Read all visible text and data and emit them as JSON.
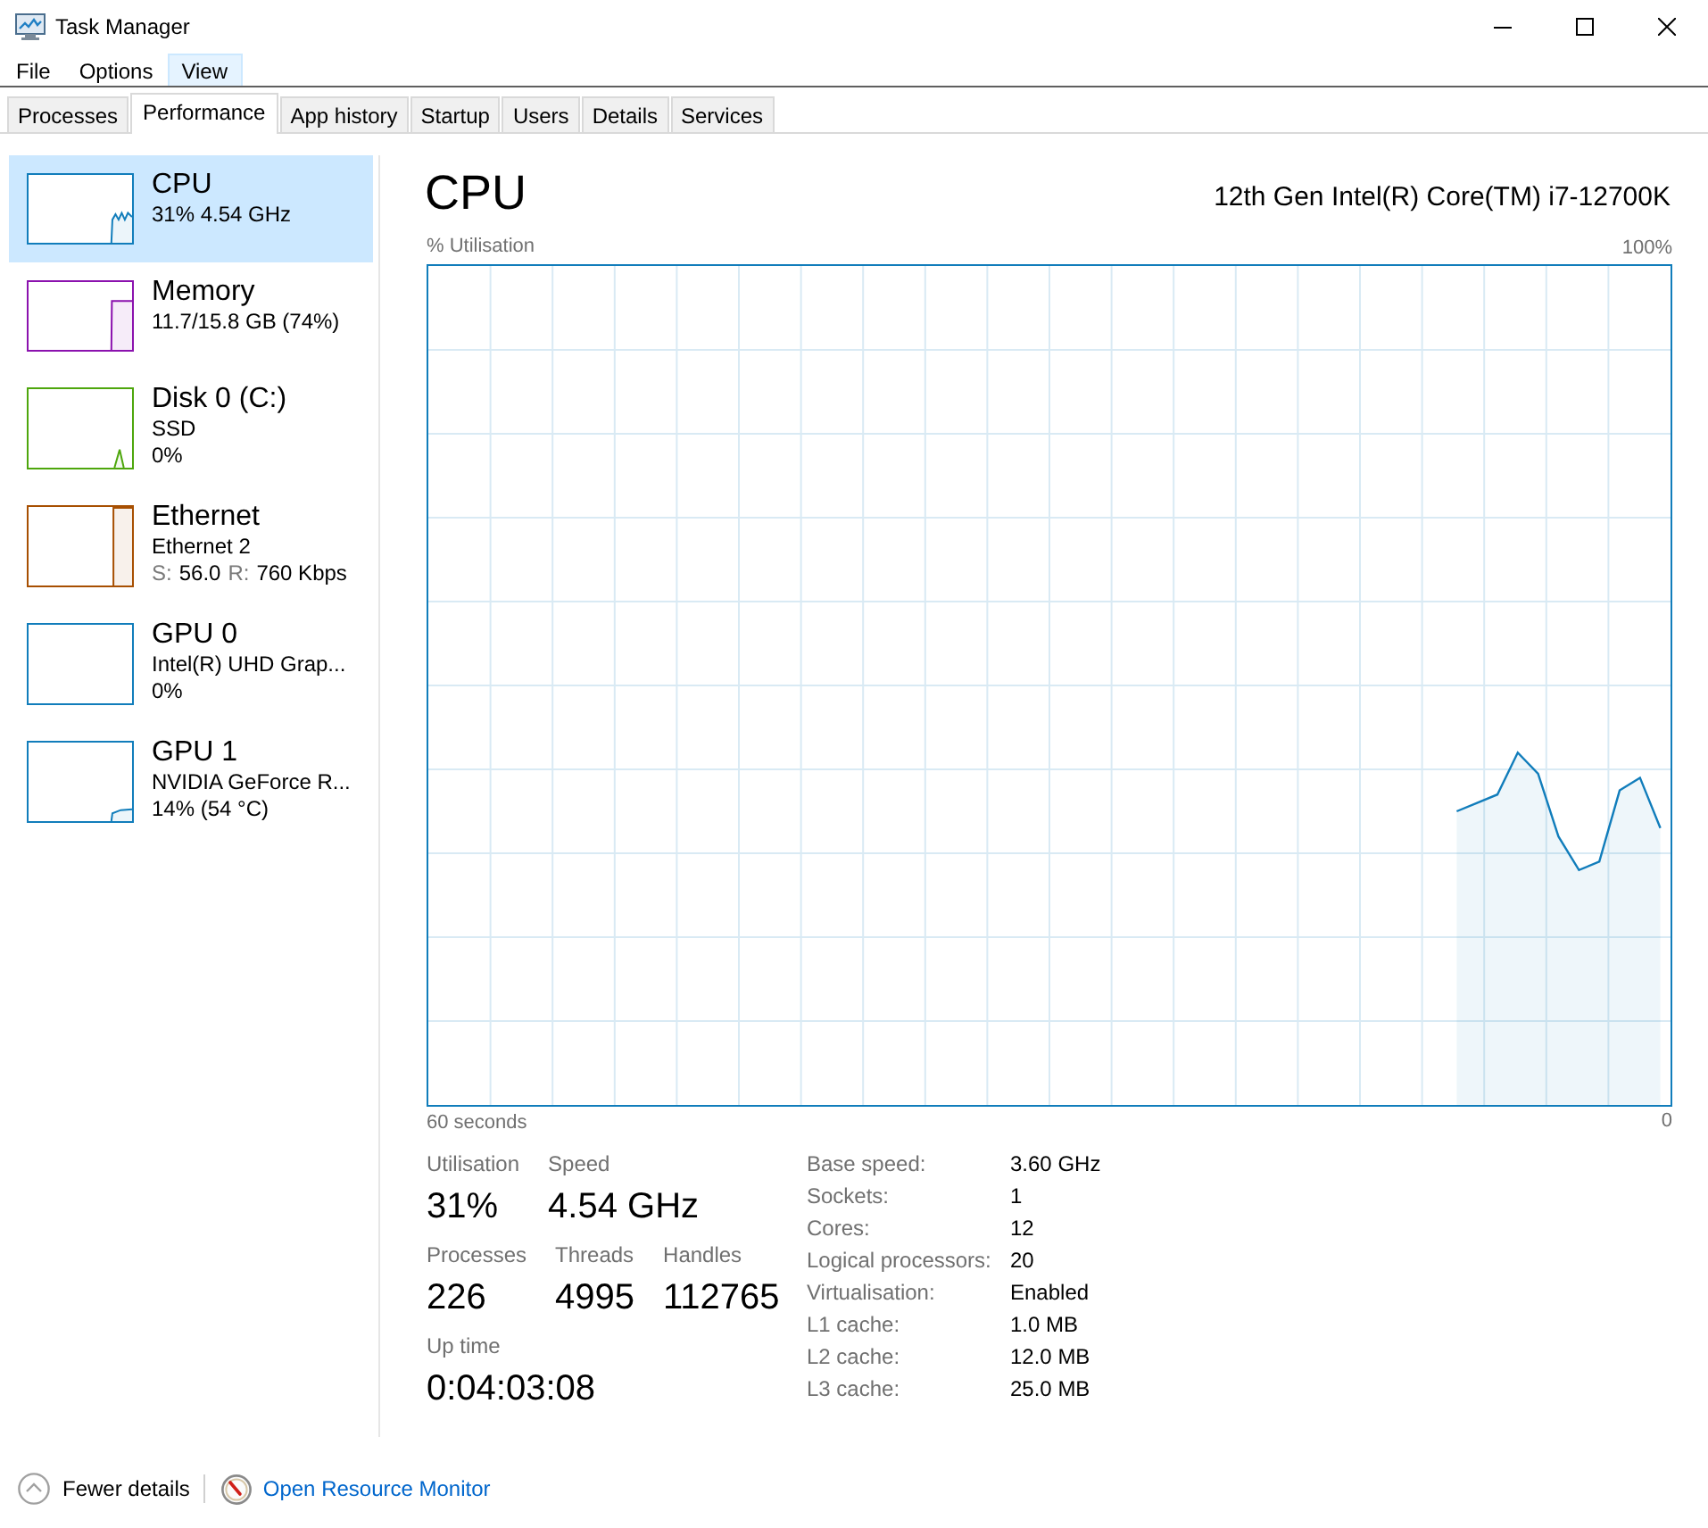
{
  "window": {
    "title": "Task Manager"
  },
  "menu": [
    {
      "label": "File",
      "selected": false
    },
    {
      "label": "Options",
      "selected": false
    },
    {
      "label": "View",
      "selected": true
    }
  ],
  "tabs": [
    {
      "label": "Processes",
      "selected": false
    },
    {
      "label": "Performance",
      "selected": true
    },
    {
      "label": "App history",
      "selected": false
    },
    {
      "label": "Startup",
      "selected": false
    },
    {
      "label": "Users",
      "selected": false
    },
    {
      "label": "Details",
      "selected": false
    },
    {
      "label": "Services",
      "selected": false
    }
  ],
  "sidebar": {
    "items": [
      {
        "name": "CPU",
        "lines": [
          "31% 4.54 GHz"
        ],
        "color": "#117dbb",
        "selected": true
      },
      {
        "name": "Memory",
        "lines": [
          "11.7/15.8 GB (74%)"
        ],
        "color": "#8b12ae",
        "selected": false
      },
      {
        "name": "Disk 0 (C:)",
        "lines": [
          "SSD",
          "0%"
        ],
        "color": "#4da60c",
        "selected": false
      },
      {
        "name": "Ethernet",
        "lines": [
          "Ethernet 2"
        ],
        "throughput": {
          "send_label": "S:",
          "send": "56.0",
          "receive_label": "R:",
          "receive": "760 Kbps"
        },
        "color": "#a74f01",
        "selected": false
      },
      {
        "name": "GPU 0",
        "lines": [
          "Intel(R) UHD Grap...",
          "0%"
        ],
        "color": "#117dbb",
        "selected": false
      },
      {
        "name": "GPU 1",
        "lines": [
          "NVIDIA GeForce R...",
          "14% (54 °C)"
        ],
        "color": "#117dbb",
        "selected": false
      }
    ]
  },
  "performance": {
    "title": "CPU",
    "model": "12th Gen Intel(R) Core(TM) i7-12700K",
    "chart_data": {
      "type": "area",
      "ylabel": "% Utilisation",
      "xlabel": "60 seconds",
      "grid": true,
      "categories": [
        null,
        null,
        null,
        null,
        null,
        null,
        null,
        null,
        null,
        null,
        null,
        null,
        null,
        null,
        null,
        null,
        null,
        null,
        null,
        null,
        null,
        null,
        null,
        null,
        null,
        null,
        null,
        null,
        null,
        null,
        null,
        null,
        null,
        null,
        null,
        null,
        null,
        null,
        null,
        null,
        null,
        null,
        null,
        null,
        null,
        null,
        null,
        null,
        null,
        null,
        null,
        null,
        null,
        null,
        null,
        null,
        null,
        null,
        null,
        null,
        null
      ],
      "ylim": [
        0,
        100
      ],
      "yticks": [
        {
          "value": 100,
          "label": "100%"
        },
        {
          "value": 0,
          "label": "0"
        }
      ],
      "series": [
        {
          "color": "#117dbb",
          "values": [
            null,
            null,
            null,
            null,
            null,
            null,
            null,
            null,
            null,
            null,
            null,
            null,
            null,
            null,
            null,
            null,
            null,
            null,
            null,
            null,
            null,
            null,
            null,
            null,
            null,
            null,
            null,
            null,
            null,
            null,
            null,
            null,
            null,
            null,
            null,
            null,
            null,
            null,
            null,
            null,
            null,
            null,
            null,
            null,
            null,
            null,
            null,
            null,
            null,
            null,
            35,
            36,
            37,
            42,
            39.5,
            32,
            28,
            29,
            37.5,
            39,
            33
          ]
        }
      ]
    },
    "stat_rows": [
      [
        {
          "label": "Utilisation",
          "value": "31%"
        },
        {
          "label": "Speed",
          "value": "4.54 GHz"
        }
      ],
      [
        {
          "label": "Processes",
          "value": "226"
        },
        {
          "label": "Threads",
          "value": "4995"
        },
        {
          "label": "Handles",
          "value": "112765"
        }
      ],
      [
        {
          "label": "Up time",
          "value": "0:04:03:08"
        }
      ]
    ],
    "details": [
      {
        "label": "Base speed:",
        "value": "3.60 GHz"
      },
      {
        "label": "Sockets:",
        "value": "1"
      },
      {
        "label": "Cores:",
        "value": "12"
      },
      {
        "label": "Logical processors:",
        "value": "20"
      },
      {
        "label": "Virtualisation:",
        "value": "Enabled"
      },
      {
        "label": "L1 cache:",
        "value": "1.0 MB"
      },
      {
        "label": "L2 cache:",
        "value": "12.0 MB"
      },
      {
        "label": "L3 cache:",
        "value": "25.0 MB"
      }
    ]
  },
  "footer": {
    "fewer_details": "Fewer details",
    "resource_monitor_link": "Open Resource Monitor"
  }
}
